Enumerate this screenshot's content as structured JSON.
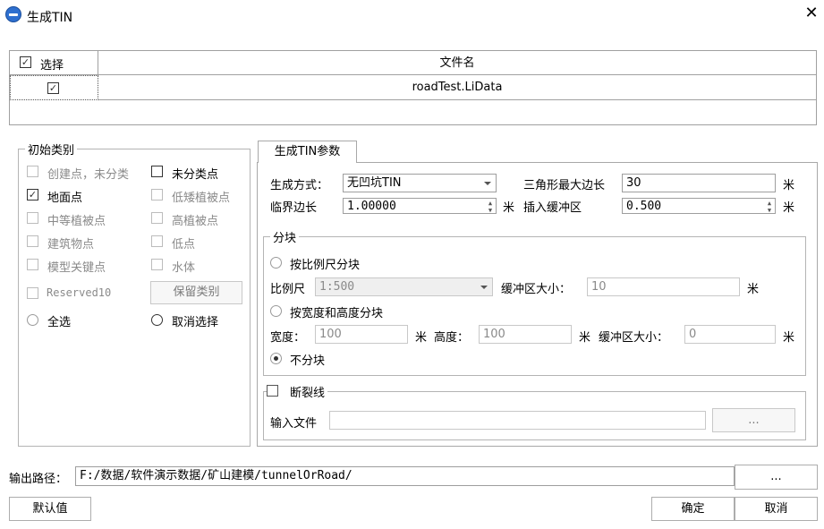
{
  "window": {
    "title": "生成TIN",
    "close_glyph": "✕"
  },
  "table": {
    "header_select": "选择",
    "header_filename": "文件名",
    "rows": [
      {
        "selected": true,
        "filename": "roadTest.LiData"
      }
    ],
    "check_glyph": "✓"
  },
  "initial_class": {
    "legend": "初始类别",
    "items": [
      {
        "label": "创建点，未分类",
        "checked": false,
        "enabled": false
      },
      {
        "label": "未分类点",
        "checked": false,
        "enabled": true
      },
      {
        "label": "地面点",
        "checked": true,
        "enabled": true
      },
      {
        "label": "低矮植被点",
        "checked": false,
        "enabled": false
      },
      {
        "label": "中等植被点",
        "checked": false,
        "enabled": false
      },
      {
        "label": "高植被点",
        "checked": false,
        "enabled": false
      },
      {
        "label": "建筑物点",
        "checked": false,
        "enabled": false
      },
      {
        "label": "低点",
        "checked": false,
        "enabled": false
      },
      {
        "label": "模型关键点",
        "checked": false,
        "enabled": false
      },
      {
        "label": "水体",
        "checked": false,
        "enabled": false
      },
      {
        "label": "Reserved10",
        "checked": false,
        "enabled": false
      }
    ],
    "keep_class_button": "保留类别",
    "select_all": "全选",
    "deselect_all": "取消选择"
  },
  "tin_params": {
    "tab_label": "生成TIN参数",
    "gen_method_label": "生成方式：",
    "gen_method_value": "无凹坑TIN",
    "max_edge_label": "三角形最大边长",
    "max_edge_value": "30",
    "unit_m": "米",
    "boundary_label": "临界边长",
    "boundary_value": "1.00000",
    "buffer_insert_label": "插入缓冲区",
    "buffer_insert_value": "0.500"
  },
  "tiling": {
    "legend": "分块",
    "by_scale": "按比例尺分块",
    "scale_label": "比例尺",
    "scale_value": "1:500",
    "buffer_size_label": "缓冲区大小：",
    "buffer_size_value": "10",
    "by_wh": "按宽度和高度分块",
    "width_label": "宽度：",
    "width_value": "100",
    "height_label": "高度：",
    "height_value": "100",
    "buffer_size2_value": "0",
    "no_tile": "不分块",
    "selected": "no_tile"
  },
  "breakline": {
    "legend": "断裂线",
    "input_label": "输入文件",
    "input_value": "",
    "browse": "..."
  },
  "output": {
    "label": "输出路径：",
    "path": "F:/数据/软件演示数据/矿山建模/tunnelOrRoad/",
    "browse": "..."
  },
  "buttons": {
    "default": "默认值",
    "ok": "确定",
    "cancel": "取消"
  }
}
